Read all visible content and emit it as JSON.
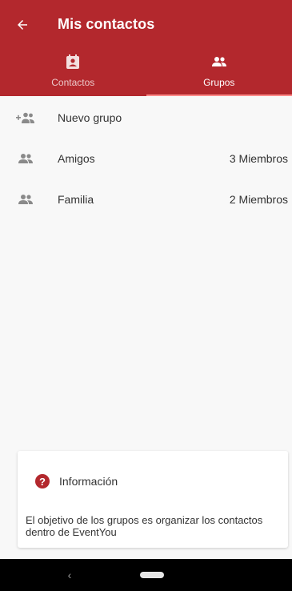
{
  "appbar": {
    "title": "Mis contactos",
    "back_icon": "arrow-left-icon",
    "background_color": "#b3282d"
  },
  "tabs": [
    {
      "label": "Contactos",
      "icon": "contact-card-icon",
      "active": false
    },
    {
      "label": "Grupos",
      "icon": "group-icon",
      "active": true
    }
  ],
  "list": {
    "new_group": {
      "label": "Nuevo grupo",
      "icon": "group-add-icon"
    },
    "groups": [
      {
        "name": "Amigos",
        "members": "3 Miembros",
        "icon": "group-icon"
      },
      {
        "name": "Familia",
        "members": "2 Miembros",
        "icon": "group-icon"
      }
    ]
  },
  "info": {
    "icon": "help-circle-icon",
    "icon_glyph": "?",
    "title": "Información",
    "text": "El objetivo de los grupos es organizar los contactos dentro de EventYou"
  },
  "system_nav": {
    "back_glyph": "‹"
  }
}
